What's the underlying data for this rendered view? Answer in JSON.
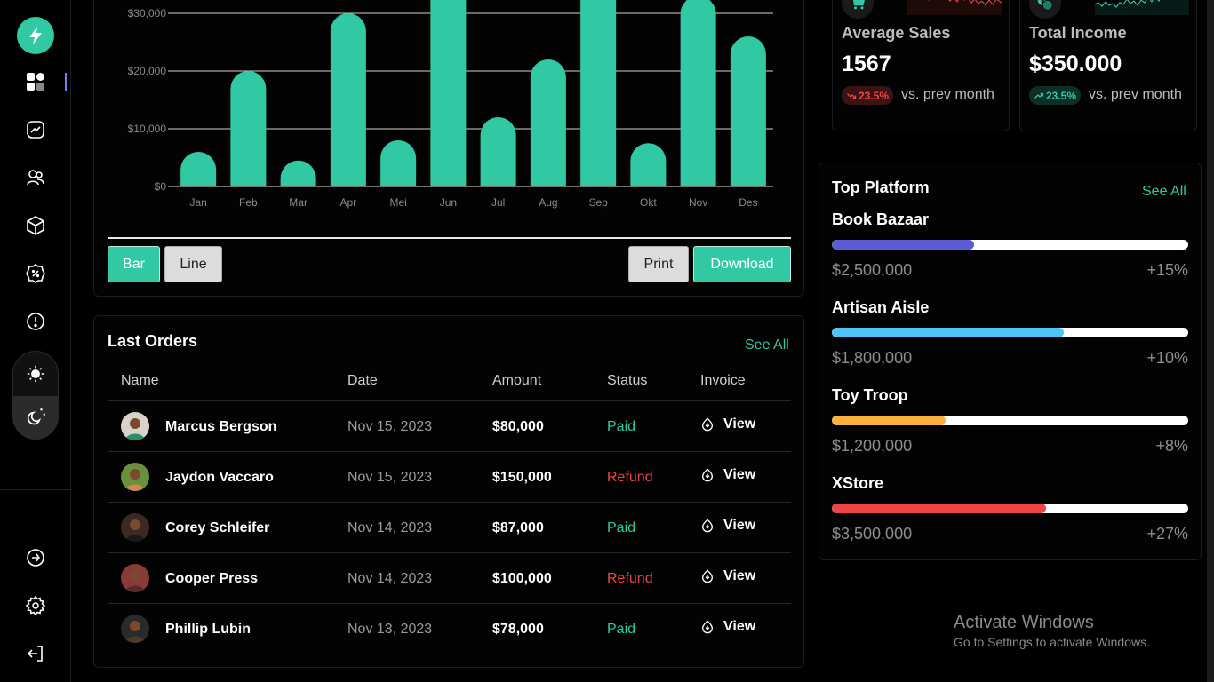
{
  "colors": {
    "accent": "#31c9a3",
    "refund": "#ef4444",
    "track": "#ffffff"
  },
  "sidebar": {
    "items": [
      {
        "icon": "dashboard-icon"
      },
      {
        "icon": "analytics-icon"
      },
      {
        "icon": "users-icon"
      },
      {
        "icon": "box-icon"
      },
      {
        "icon": "badge-discount-icon"
      },
      {
        "icon": "alert-icon"
      }
    ],
    "bottom": [
      {
        "icon": "arrow-right-circle-icon"
      },
      {
        "icon": "settings-icon"
      },
      {
        "icon": "logout-icon"
      }
    ]
  },
  "chart_data": {
    "type": "bar",
    "categories": [
      "Jan",
      "Feb",
      "Mar",
      "Apr",
      "Mei",
      "Jun",
      "Jul",
      "Aug",
      "Sep",
      "Okt",
      "Nov",
      "Des"
    ],
    "values": [
      6000,
      20000,
      4500,
      30000,
      8000,
      38000,
      12000,
      22000,
      38000,
      7500,
      33000,
      26000
    ],
    "yticks": [
      "$0",
      "$10,000",
      "$20,000",
      "$30,000"
    ],
    "ytick_values": [
      0,
      10000,
      20000,
      30000
    ],
    "ylim": [
      0,
      32000
    ],
    "grid": true,
    "color": "#31c9a3"
  },
  "chart_controls": {
    "bar": "Bar",
    "line": "Line",
    "print": "Print",
    "download": "Download"
  },
  "orders": {
    "title": "Last Orders",
    "see_all": "See All",
    "headers": {
      "name": "Name",
      "date": "Date",
      "amount": "Amount",
      "status": "Status",
      "invoice": "Invoice"
    },
    "rows": [
      {
        "name": "Marcus Bergson",
        "date": "Nov 15, 2023",
        "amount": "$80,000",
        "status": "Paid",
        "invoice": "View"
      },
      {
        "name": "Jaydon Vaccaro",
        "date": "Nov 15, 2023",
        "amount": "$150,000",
        "status": "Refund",
        "invoice": "View"
      },
      {
        "name": "Corey Schleifer",
        "date": "Nov 14, 2023",
        "amount": "$87,000",
        "status": "Paid",
        "invoice": "View"
      },
      {
        "name": "Cooper Press",
        "date": "Nov 14, 2023",
        "amount": "$100,000",
        "status": "Refund",
        "invoice": "View"
      },
      {
        "name": "Phillip Lubin",
        "date": "Nov 13, 2023",
        "amount": "$78,000",
        "status": "Paid",
        "invoice": "View"
      }
    ]
  },
  "stats": {
    "average": {
      "label": "Average Sales",
      "value": "1567",
      "change": "23.5%",
      "suffix": "vs. prev month",
      "trend": "down"
    },
    "income": {
      "label": "Total Income",
      "value": "$350.000",
      "change": "23.5%",
      "suffix": "vs. prev month",
      "trend": "up"
    }
  },
  "platform": {
    "title": "Top Platform",
    "see_all": "See All",
    "items": [
      {
        "name": "Book Bazaar",
        "amount": "$2,500,000",
        "change": "+15%",
        "progress": 0.4,
        "color": "#5b5bd6"
      },
      {
        "name": "Artisan Aisle",
        "amount": "$1,800,000",
        "change": "+10%",
        "progress": 0.65,
        "color": "#4fc3f7"
      },
      {
        "name": "Toy Troop",
        "amount": "$1,200,000",
        "change": "+8%",
        "progress": 0.32,
        "color": "#fbb13c"
      },
      {
        "name": "XStore",
        "amount": "$3,500,000",
        "change": "+27%",
        "progress": 0.6,
        "color": "#ef4444"
      }
    ]
  },
  "watermark": {
    "title": "Activate Windows",
    "subtitle": "Go to Settings to activate Windows."
  }
}
